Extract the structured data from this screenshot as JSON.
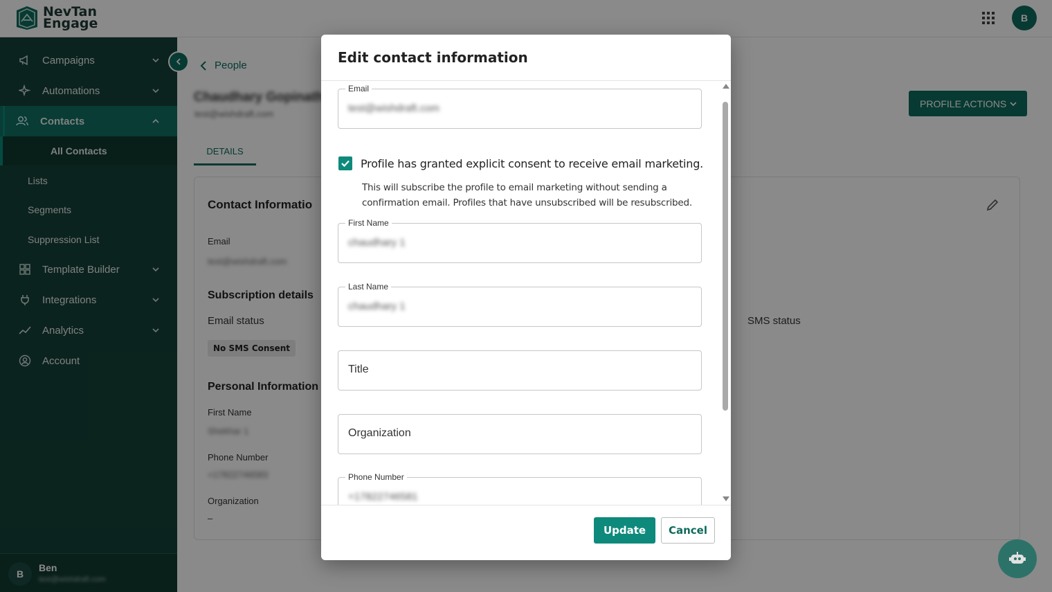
{
  "app": {
    "brand_line1": "NevTan",
    "brand_line2": "Engage",
    "user_initial": "B"
  },
  "sidebar": {
    "items": [
      {
        "label": "Campaigns",
        "icon": "megaphone-icon"
      },
      {
        "label": "Automations",
        "icon": "sparkle-icon"
      },
      {
        "label": "Contacts",
        "icon": "people-icon"
      },
      {
        "label": "Template Builder",
        "icon": "grid-icon"
      },
      {
        "label": "Integrations",
        "icon": "plug-icon"
      },
      {
        "label": "Analytics",
        "icon": "trend-icon"
      },
      {
        "label": "Account",
        "icon": "account-circle-icon"
      }
    ],
    "contacts_sub": [
      "All Contacts",
      "Lists",
      "Segments",
      "Suppression List"
    ],
    "user": {
      "initial": "B",
      "name": "Ben",
      "email": "test@wishdraft.com"
    }
  },
  "page": {
    "breadcrumb": "People",
    "profile_name": "Chaudhary Gopinath",
    "profile_email": "test@wishdraft.com",
    "profile_actions_label": "PROFILE ACTIONS",
    "tab_details": "DETAILS",
    "card": {
      "contact_heading": "Contact Informatio",
      "email_label": "Email",
      "email_value": "test@wishdraft.com",
      "subscription_heading": "Subscription details",
      "email_status_label": "Email status",
      "sms_status_label": "SMS status",
      "sms_badge": "No SMS Consent",
      "personal_heading": "Personal Information",
      "first_name_label": "First Name",
      "first_name_value": "Shekhar 1",
      "phone_label": "Phone Number",
      "phone_value": "+17822746583",
      "org_label": "Organization",
      "org_value": "–"
    }
  },
  "modal": {
    "title": "Edit contact information",
    "email_label": "Email",
    "email_value": "test@wishdraft.com",
    "consent_checked": true,
    "consent_label": "Profile has granted explicit consent to receive email marketing.",
    "consent_help": "This will subscribe the profile to email marketing without sending a confirmation email. Profiles that have unsubscribed will be resubscribed.",
    "first_name_label": "First Name",
    "first_name_value": "chaudhary 1",
    "last_name_label": "Last Name",
    "last_name_value": "chaudhary 1",
    "title_placeholder": "Title",
    "organization_placeholder": "Organization",
    "phone_label": "Phone Number",
    "phone_value": "+17822746581",
    "update_label": "Update",
    "cancel_label": "Cancel"
  },
  "colors": {
    "primary": "#0e6b5d",
    "sidebar_bg": "#164238",
    "active_nav": "#0f6f60",
    "accent": "#0e8a7c"
  }
}
